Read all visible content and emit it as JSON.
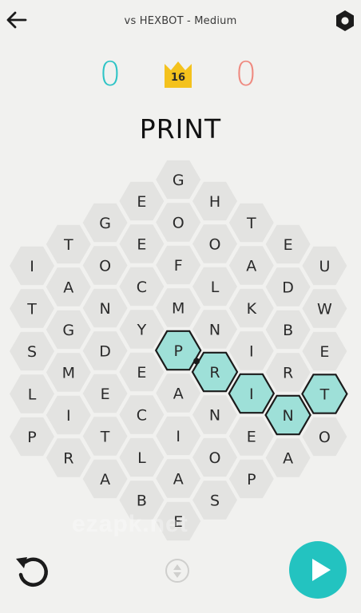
{
  "header": {
    "title": "vs HEXBOT - Medium",
    "back_icon": "arrow-left-icon",
    "settings_icon": "hexagon-settings-icon"
  },
  "scores": {
    "player": "0",
    "opponent": "0",
    "player_color": "#2ec4c6",
    "opponent_color": "#ef8a80",
    "crown_value": "16",
    "crown_color": "#f4c21d",
    "crown_icon": "crown-icon"
  },
  "word": "PRINT",
  "board": {
    "tile_color": "#e3e3e1",
    "selected_color": "#9ee0d8",
    "tiles": [
      {
        "letter": "I",
        "col": 0,
        "row": 0
      },
      {
        "letter": "T",
        "col": 0,
        "row": 1
      },
      {
        "letter": "S",
        "col": 0,
        "row": 2
      },
      {
        "letter": "L",
        "col": 0,
        "row": 3
      },
      {
        "letter": "P",
        "col": 0,
        "row": 4
      },
      {
        "letter": "T",
        "col": 1,
        "row": 0
      },
      {
        "letter": "A",
        "col": 1,
        "row": 1
      },
      {
        "letter": "G",
        "col": 1,
        "row": 2
      },
      {
        "letter": "M",
        "col": 1,
        "row": 3
      },
      {
        "letter": "I",
        "col": 1,
        "row": 4
      },
      {
        "letter": "R",
        "col": 1,
        "row": 5
      },
      {
        "letter": "G",
        "col": 2,
        "row": 0
      },
      {
        "letter": "O",
        "col": 2,
        "row": 1
      },
      {
        "letter": "N",
        "col": 2,
        "row": 2
      },
      {
        "letter": "D",
        "col": 2,
        "row": 3
      },
      {
        "letter": "E",
        "col": 2,
        "row": 4
      },
      {
        "letter": "T",
        "col": 2,
        "row": 5
      },
      {
        "letter": "A",
        "col": 2,
        "row": 6
      },
      {
        "letter": "E",
        "col": 3,
        "row": 0
      },
      {
        "letter": "E",
        "col": 3,
        "row": 1
      },
      {
        "letter": "C",
        "col": 3,
        "row": 2
      },
      {
        "letter": "Y",
        "col": 3,
        "row": 3
      },
      {
        "letter": "E",
        "col": 3,
        "row": 4
      },
      {
        "letter": "C",
        "col": 3,
        "row": 5
      },
      {
        "letter": "L",
        "col": 3,
        "row": 6
      },
      {
        "letter": "B",
        "col": 3,
        "row": 7
      },
      {
        "letter": "G",
        "col": 4,
        "row": 0
      },
      {
        "letter": "O",
        "col": 4,
        "row": 1
      },
      {
        "letter": "F",
        "col": 4,
        "row": 2
      },
      {
        "letter": "M",
        "col": 4,
        "row": 3
      },
      {
        "letter": "P",
        "col": 4,
        "row": 4,
        "selected": true
      },
      {
        "letter": "A",
        "col": 4,
        "row": 5
      },
      {
        "letter": "I",
        "col": 4,
        "row": 6
      },
      {
        "letter": "A",
        "col": 4,
        "row": 7
      },
      {
        "letter": "E",
        "col": 4,
        "row": 8
      },
      {
        "letter": "H",
        "col": 5,
        "row": 0
      },
      {
        "letter": "O",
        "col": 5,
        "row": 1
      },
      {
        "letter": "L",
        "col": 5,
        "row": 2
      },
      {
        "letter": "N",
        "col": 5,
        "row": 3
      },
      {
        "letter": "R",
        "col": 5,
        "row": 4,
        "selected": true
      },
      {
        "letter": "N",
        "col": 5,
        "row": 5
      },
      {
        "letter": "O",
        "col": 5,
        "row": 6
      },
      {
        "letter": "S",
        "col": 5,
        "row": 7
      },
      {
        "letter": "T",
        "col": 6,
        "row": 0
      },
      {
        "letter": "A",
        "col": 6,
        "row": 1
      },
      {
        "letter": "K",
        "col": 6,
        "row": 2
      },
      {
        "letter": "I",
        "col": 6,
        "row": 3
      },
      {
        "letter": "I",
        "col": 6,
        "row": 4,
        "selected": true
      },
      {
        "letter": "E",
        "col": 6,
        "row": 5
      },
      {
        "letter": "P",
        "col": 6,
        "row": 6
      },
      {
        "letter": "E",
        "col": 7,
        "row": 0
      },
      {
        "letter": "D",
        "col": 7,
        "row": 1
      },
      {
        "letter": "B",
        "col": 7,
        "row": 2
      },
      {
        "letter": "R",
        "col": 7,
        "row": 3
      },
      {
        "letter": "N",
        "col": 7,
        "row": 4,
        "selected": true
      },
      {
        "letter": "A",
        "col": 7,
        "row": 5
      },
      {
        "letter": "U",
        "col": 8,
        "row": 0
      },
      {
        "letter": "W",
        "col": 8,
        "row": 1
      },
      {
        "letter": "E",
        "col": 8,
        "row": 2
      },
      {
        "letter": "T",
        "col": 8,
        "row": 3,
        "selected": true
      },
      {
        "letter": "O",
        "col": 8,
        "row": 4
      }
    ]
  },
  "controls": {
    "undo_icon": "undo-arrow-icon",
    "shuffle_icon": "shuffle-circle-icon",
    "play_icon": "play-icon",
    "play_color": "#23c3c0"
  },
  "watermark": "ezapk.net"
}
